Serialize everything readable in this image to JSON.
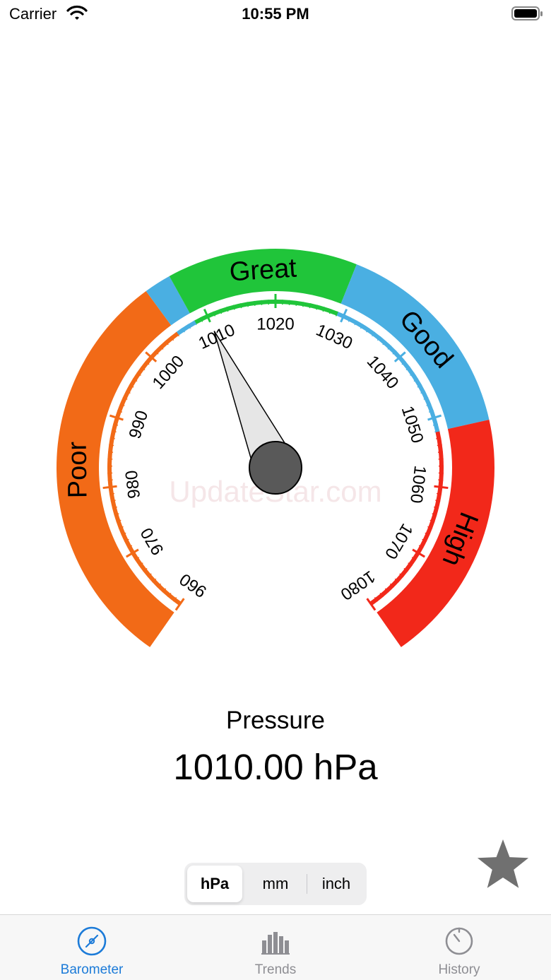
{
  "status_bar": {
    "carrier": "Carrier",
    "time": "10:55 PM"
  },
  "gauge": {
    "min": 960,
    "max": 1080,
    "needle_value": 1010,
    "ticks": [
      "960",
      "970",
      "980",
      "990",
      "1000",
      "1010",
      "1020",
      "1030",
      "1040",
      "1050",
      "1060",
      "1070",
      "1080"
    ],
    "zones": [
      {
        "label": "Poor",
        "from": 960,
        "to": 1005,
        "color": "#f26a17"
      },
      {
        "label": "",
        "from": 1005,
        "to": 1008,
        "color": "#4aafe2"
      },
      {
        "label": "Great",
        "from": 1008,
        "to": 1029,
        "color": "#20c53a"
      },
      {
        "label": "Good",
        "from": 1029,
        "to": 1052,
        "color": "#4aafe2"
      },
      {
        "label": "High",
        "from": 1052,
        "to": 1080,
        "color": "#f2281a"
      }
    ],
    "watermark": "UpdateStar.com"
  },
  "reading": {
    "label": "Pressure",
    "value": "1010.00 hPa"
  },
  "units": {
    "options": [
      "hPa",
      "mm",
      "inch"
    ],
    "selected": "hPa"
  },
  "tabs": [
    {
      "label": "Barometer",
      "icon": "compass-icon",
      "active": true
    },
    {
      "label": "Trends",
      "icon": "bar-chart-icon",
      "active": false
    },
    {
      "label": "History",
      "icon": "timer-icon",
      "active": false
    }
  ],
  "colors": {
    "accent": "#1c7bd8",
    "inactive": "#8e8e93",
    "needle_hub": "#595959",
    "star": "#707070"
  }
}
